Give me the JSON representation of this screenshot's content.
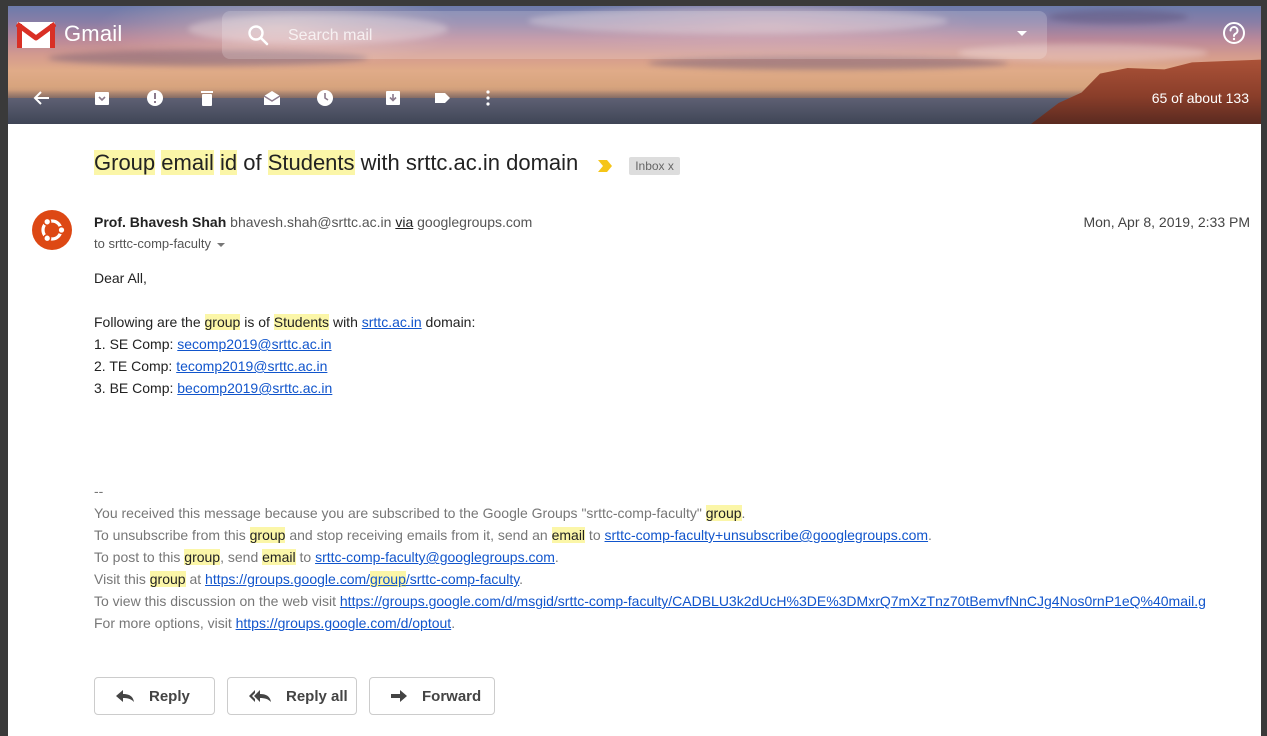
{
  "header": {
    "app_name": "Gmail",
    "search_placeholder": "Search mail",
    "counter": "65 of about 133"
  },
  "email": {
    "subject": {
      "parts": [
        {
          "text": "Group",
          "highlight": true
        },
        {
          "text": " ",
          "highlight": false
        },
        {
          "text": "email",
          "highlight": true
        },
        {
          "text": " ",
          "highlight": false
        },
        {
          "text": "id",
          "highlight": true
        },
        {
          "text": " of ",
          "highlight": false
        },
        {
          "text": "Students",
          "highlight": true
        },
        {
          "text": " with srttc.ac.in domain",
          "highlight": false
        }
      ]
    },
    "label": "Inbox",
    "label_close": "x",
    "sender_name": "Prof. Bhavesh Shah",
    "sender_email": "bhavesh.shah@srttc.ac.in",
    "via_text": "via",
    "via_domain": "googlegroups.com",
    "date": "Mon, Apr 8, 2019, 2:33 PM",
    "to_line": "to srttc-comp-faculty",
    "greeting": "Dear All,",
    "intro": {
      "p1": "Following are the ",
      "h1": "group",
      "p2": " is of ",
      "h2": "Students",
      "p3": " with ",
      "link": "srttc.ac.in",
      "p4": " domain:"
    },
    "list": [
      {
        "prefix": "1. SE Comp: ",
        "link": "secomp2019@srttc.ac.in"
      },
      {
        "prefix": "2. TE Comp: ",
        "link": "tecomp2019@srttc.ac.in"
      },
      {
        "prefix": "3. BE Comp: ",
        "link": "becomp2019@srttc.ac.in"
      }
    ],
    "footer": {
      "separator": "--",
      "l1_a": "You received this message because you are subscribed to the Google Groups \"srttc-comp-faculty\" ",
      "l1_h": "group",
      "l1_b": ".",
      "l2_a": "To unsubscribe from this ",
      "l2_h1": "group",
      "l2_b": " and stop receiving emails from it, send an ",
      "l2_h2": "email",
      "l2_c": " to ",
      "l2_link": "srttc-comp-faculty+unsubscribe@googlegroups.com",
      "l2_d": ".",
      "l3_a": "To post to this ",
      "l3_h1": "group",
      "l3_b": ", send ",
      "l3_h2": "email",
      "l3_c": " to ",
      "l3_link": "srttc-comp-faculty@googlegroups.com",
      "l3_d": ".",
      "l4_a": "Visit this ",
      "l4_h": "group",
      "l4_b": " at ",
      "l4_link1": "https://groups.google.com/",
      "l4_link_h": "group",
      "l4_link2": "/srttc-comp-faculty",
      "l4_c": ".",
      "l5_a": "To view this discussion on the web visit ",
      "l5_link": "https://groups.google.com/d/msgid/srttc-comp-faculty/CADBLU3k2dUcH%3DE%3DMxrQ7mXzTnz70tBemvfNnCJg4Nos0rnP1eQ%40mail.g",
      "l6_a": "For more options, visit ",
      "l6_link": "https://groups.google.com/d/optout",
      "l6_b": "."
    }
  },
  "actions": {
    "reply": "Reply",
    "reply_all": "Reply all",
    "forward": "Forward"
  },
  "colors": {
    "highlight": "#fbf6a8",
    "link": "#1155cc",
    "gmail_red": "#d93025",
    "ubuntu_orange": "#dd4814"
  }
}
